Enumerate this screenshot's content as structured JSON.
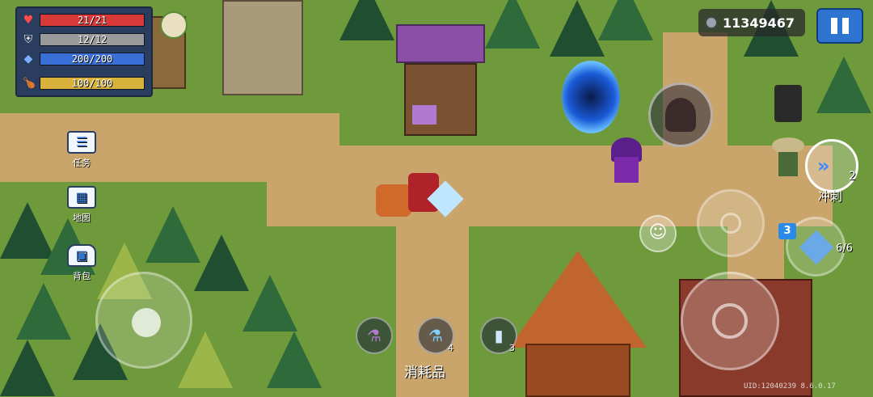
{
  "status": {
    "hp": {
      "text": "21/21",
      "fraction": 1.0,
      "color": "#d83a3a",
      "icon": "heart-icon"
    },
    "armor": {
      "text": "12/12",
      "fraction": 1.0,
      "color": "#9a9a9a",
      "icon": "shield-icon"
    },
    "energy": {
      "text": "200/200",
      "fraction": 1.0,
      "color": "#3b6fd8",
      "icon": "diamond-icon"
    },
    "xp": {
      "text": "100/100",
      "fraction": 1.0,
      "color": "#d8b23a",
      "icon": "drumstick-icon"
    }
  },
  "currency": {
    "value": "11349467",
    "icon": "coin-icon"
  },
  "sidebar": {
    "tasks_label": "任务",
    "map_label": "地图",
    "backpack_label": "背包"
  },
  "consumables": {
    "label": "消耗品",
    "slots": [
      {
        "icon": "purple-potion-icon",
        "count": ""
      },
      {
        "icon": "blue-potion-icon",
        "count": "4"
      },
      {
        "icon": "soda-can-icon",
        "count": "3"
      }
    ]
  },
  "skills": {
    "dash_label": "冲刺",
    "dash_count": "2",
    "weapon_ammo": "6/6",
    "weapon_energy_cost": "3"
  },
  "uid_text": "UID:12040239 8.6.0.17"
}
